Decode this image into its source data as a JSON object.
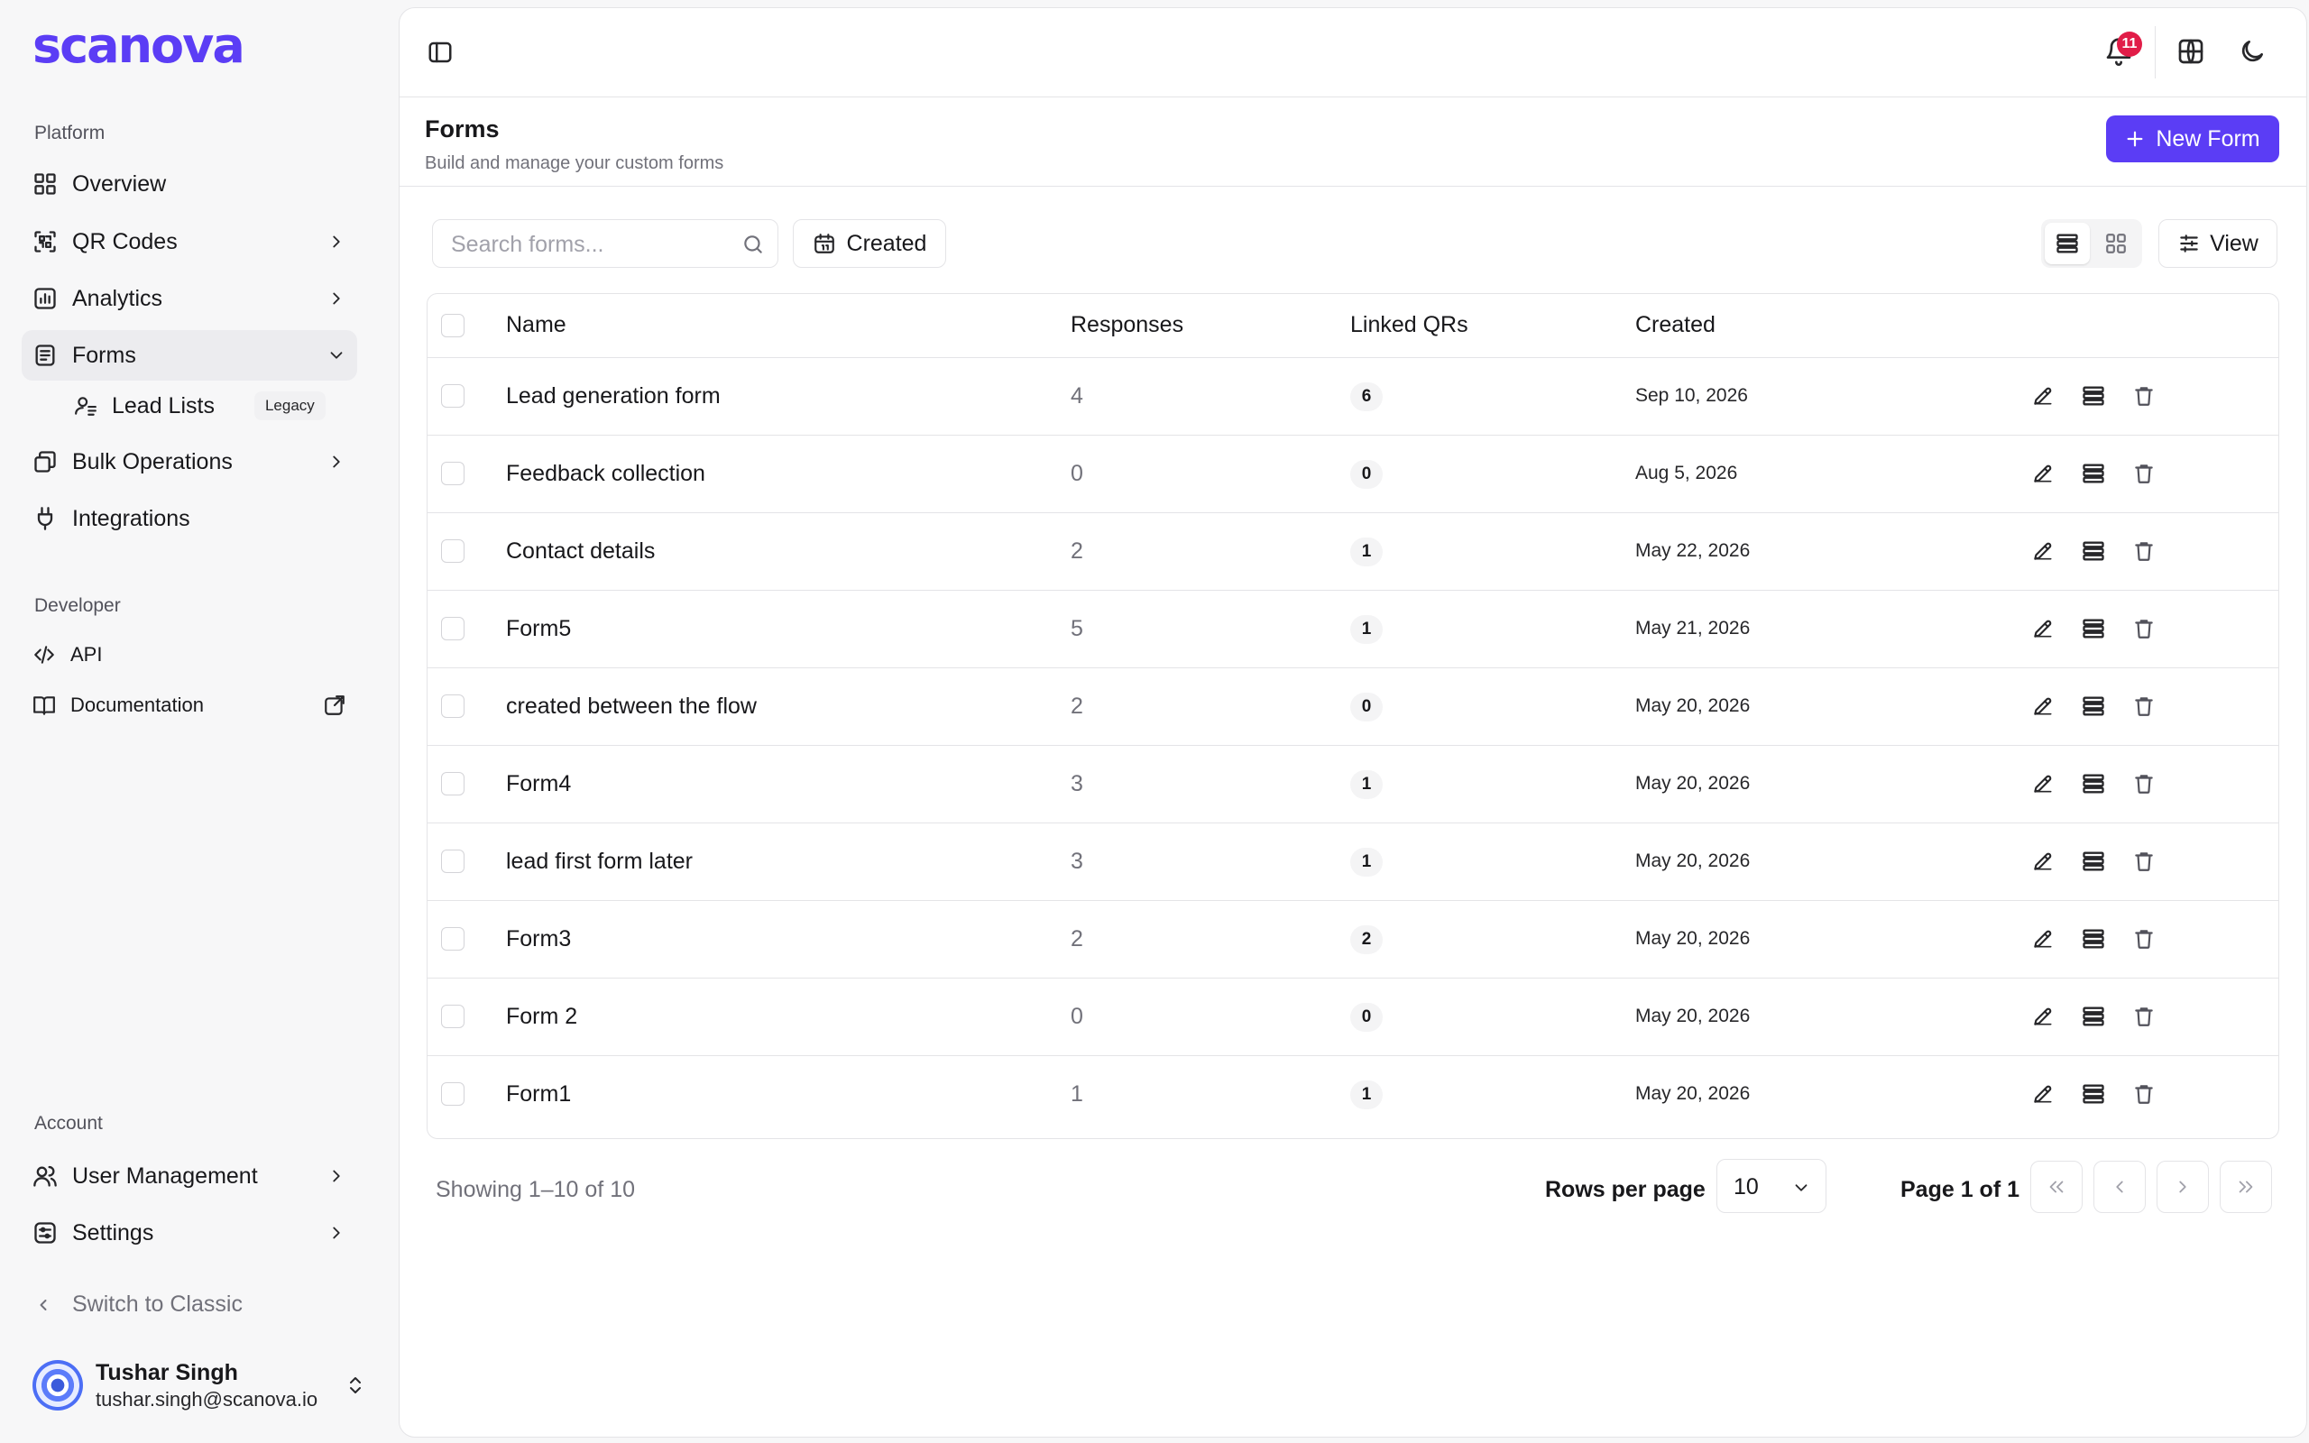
{
  "brand": {
    "name": "scanova",
    "color": "#5b3df5"
  },
  "sidebar": {
    "platform_label": "Platform",
    "items": [
      {
        "label": "Overview",
        "icon": "dashboard-icon"
      },
      {
        "label": "QR Codes",
        "icon": "qr-scan-icon"
      },
      {
        "label": "Analytics",
        "icon": "chart-icon"
      },
      {
        "label": "Forms",
        "icon": "forms-icon"
      },
      {
        "label": "Lead Lists",
        "icon": "user-list-icon",
        "tag": "Legacy"
      },
      {
        "label": "Bulk Operations",
        "icon": "layers-icon"
      },
      {
        "label": "Integrations",
        "icon": "plug-icon"
      }
    ],
    "developer_label": "Developer",
    "dev_items": [
      {
        "label": "API",
        "icon": "code-icon"
      },
      {
        "label": "Documentation",
        "icon": "book-icon"
      }
    ],
    "account_label": "Account",
    "account_items": [
      {
        "label": "User Management",
        "icon": "users-icon"
      },
      {
        "label": "Settings",
        "icon": "settings-icon"
      }
    ],
    "switch_classic": "Switch to Classic",
    "user": {
      "name": "Tushar Singh",
      "email": "tushar.singh@scanova.io"
    }
  },
  "topbar": {
    "notification_count": "11"
  },
  "page": {
    "title": "Forms",
    "subtitle": "Build and manage your custom forms",
    "new_button": "New Form"
  },
  "toolbar": {
    "search_placeholder": "Search forms...",
    "date_filter": "Created",
    "view_button": "View"
  },
  "table": {
    "columns": [
      "Name",
      "Responses",
      "Linked QRs",
      "Created"
    ],
    "rows": [
      {
        "name": "Lead generation form",
        "responses": "4",
        "linked": "6",
        "created": "Sep 10, 2026"
      },
      {
        "name": "Feedback collection",
        "responses": "0",
        "linked": "0",
        "created": "Aug 5, 2026"
      },
      {
        "name": "Contact details",
        "responses": "2",
        "linked": "1",
        "created": "May 22, 2026"
      },
      {
        "name": "Form5",
        "responses": "5",
        "linked": "1",
        "created": "May 21, 2026"
      },
      {
        "name": "created between the flow",
        "responses": "2",
        "linked": "0",
        "created": "May 20, 2026"
      },
      {
        "name": "Form4",
        "responses": "3",
        "linked": "1",
        "created": "May 20, 2026"
      },
      {
        "name": "lead first form later",
        "responses": "3",
        "linked": "1",
        "created": "May 20, 2026"
      },
      {
        "name": "Form3",
        "responses": "2",
        "linked": "2",
        "created": "May 20, 2026"
      },
      {
        "name": "Form 2",
        "responses": "0",
        "linked": "0",
        "created": "May 20, 2026"
      },
      {
        "name": "Form1",
        "responses": "1",
        "linked": "1",
        "created": "May 20, 2026"
      }
    ]
  },
  "pagination": {
    "showing": "Showing 1–10 of 10",
    "rows_per_page_label": "Rows per page",
    "rows_per_page": "10",
    "page_of": "Page 1 of 1"
  }
}
